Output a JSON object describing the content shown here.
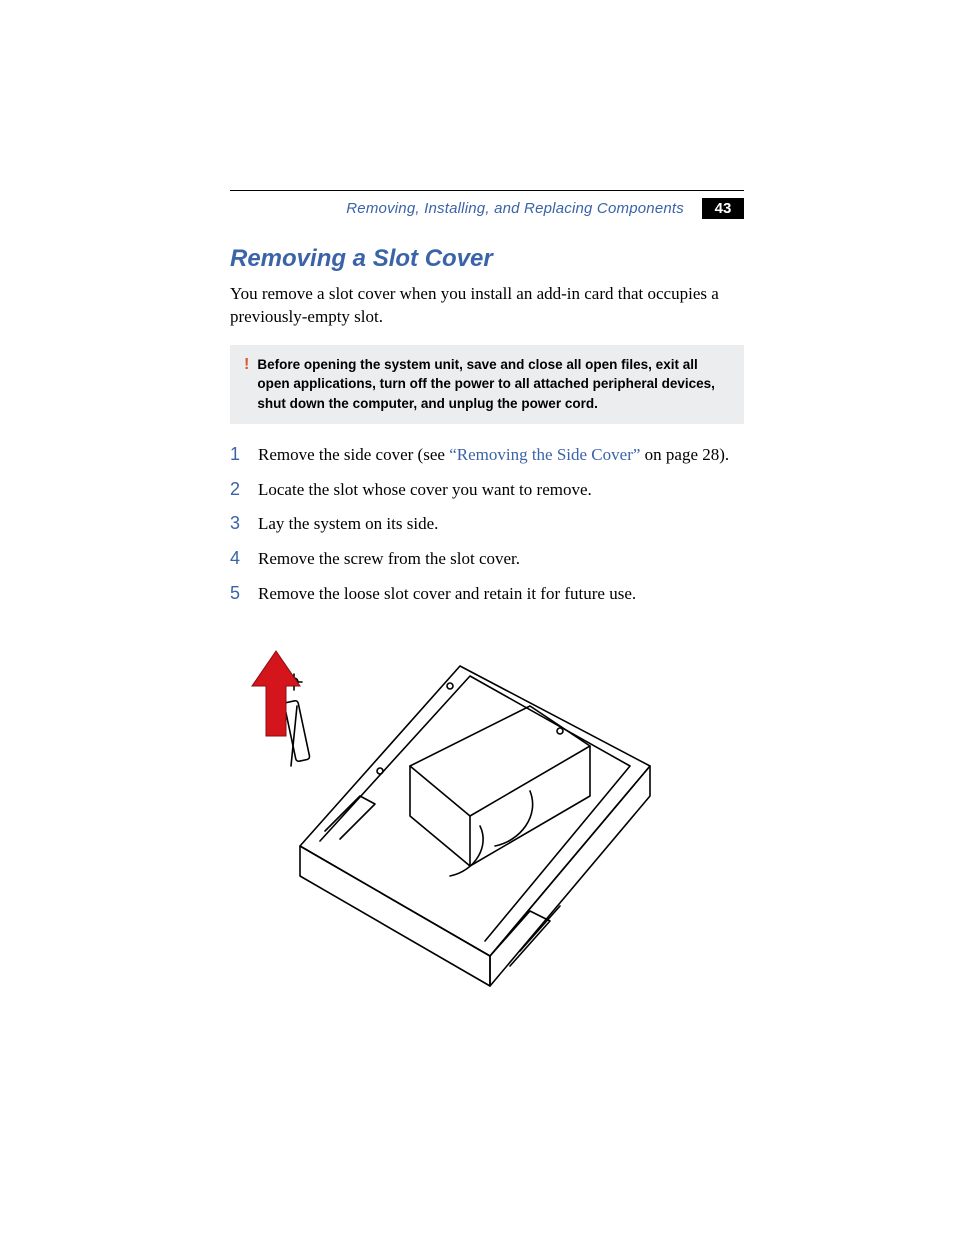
{
  "header": {
    "running_title": "Removing, Installing, and Replacing Components",
    "page_number": "43"
  },
  "section": {
    "title": "Removing a Slot Cover",
    "intro": "You remove a slot cover when you install an add-in card that occupies a previously-empty slot."
  },
  "caution": {
    "mark": "!",
    "text": "Before opening the system unit, save and close all open files, exit all open applications, turn off the power to all attached peripheral devices, shut down the computer, and unplug the power cord."
  },
  "steps": {
    "s1_pre": "Remove the side cover (see ",
    "s1_link": "“Removing the Side Cover”",
    "s1_post": " on page 28).",
    "s2": "Locate the slot whose cover you want to remove.",
    "s3": "Lay the system on its side.",
    "s4": "Remove the screw from the slot cover.",
    "s5": "Remove the loose slot cover and retain it for future use."
  },
  "figure": {
    "alt": "Isometric line drawing of an open desktop chassis lying on its side, with a red arrow showing the slot cover and screw being lifted upward out of the rear slot area."
  }
}
